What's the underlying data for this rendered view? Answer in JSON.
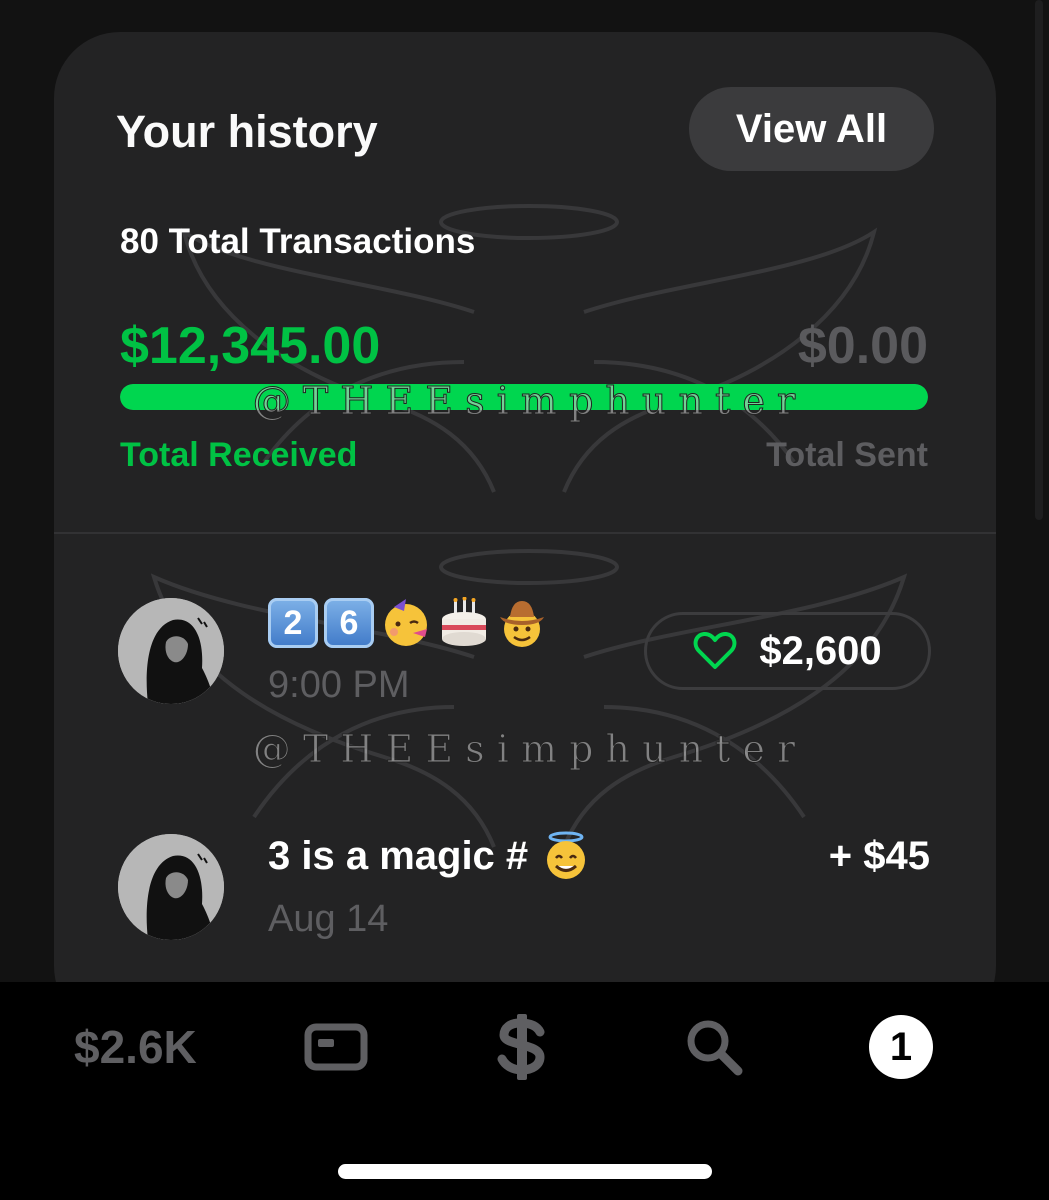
{
  "history": {
    "title": "Your history",
    "view_all_label": "View All",
    "total_transactions": "80 Total Transactions",
    "total_received_amount": "$12,345.00",
    "total_sent_amount": "$0.00",
    "total_received_label": "Total Received",
    "total_sent_label": "Total Sent",
    "received_share": 1.0
  },
  "transactions": [
    {
      "title_keycaps": [
        "2",
        "6"
      ],
      "title_emoji": [
        "partying-face",
        "birthday-cake",
        "cowboy-face"
      ],
      "time": "9:00 PM",
      "amount": "$2,600",
      "liked": true
    },
    {
      "title": "3 is a magic #",
      "title_emoji": [
        "smiling-face-with-halo"
      ],
      "time": "Aug 14",
      "amount": "+ $45"
    }
  ],
  "watermark_text": "@ T H E E s i m p h u n t e r",
  "tabbar": {
    "balance_label": "$2.6K",
    "activity_badge": "1",
    "icons": [
      "card-icon",
      "dollar-icon",
      "search-icon",
      "activity-badge"
    ]
  },
  "colors": {
    "accent_green": "#00d64f",
    "card_bg": "#232324",
    "muted_text": "#5e5e61"
  }
}
